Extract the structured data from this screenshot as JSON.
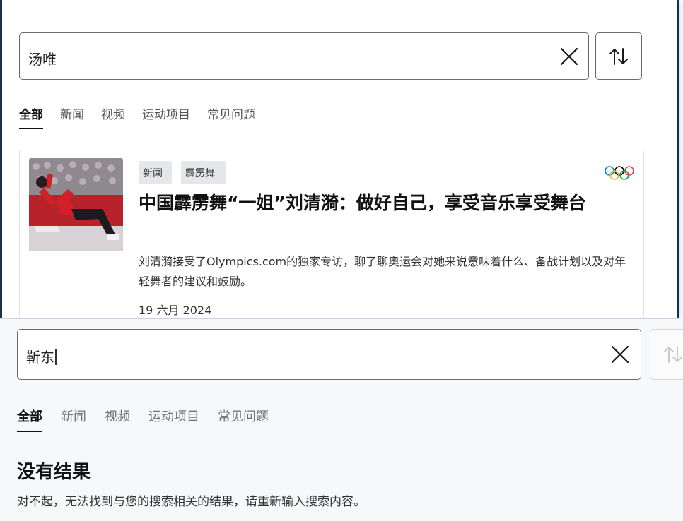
{
  "top_search": {
    "query": "汤唯",
    "tabs": [
      {
        "label": "全部",
        "active": true
      },
      {
        "label": "新闻",
        "active": false
      },
      {
        "label": "视频",
        "active": false
      },
      {
        "label": "运动项目",
        "active": false
      },
      {
        "label": "常见问题",
        "active": false
      }
    ],
    "result": {
      "tags": [
        "新闻",
        "霹雳舞"
      ],
      "headline": "中国霹雳舞“一姐”刘清漪：做好自己，享受音乐享受舞台",
      "description": "刘清漪接受了Olympics.com的独家专访，聊了聊奥运会对她来说意味着什么、备战计划以及对年轻舞者的建议和鼓励。",
      "date": "19 六月 2024"
    }
  },
  "bottom_search": {
    "query": "靳东",
    "tabs": [
      {
        "label": "全部",
        "active": true
      },
      {
        "label": "新闻",
        "active": false
      },
      {
        "label": "视频",
        "active": false
      },
      {
        "label": "运动项目",
        "active": false
      },
      {
        "label": "常见问题",
        "active": false
      }
    ],
    "empty_state": {
      "title": "没有结果",
      "message": "对不起，无法找到与您的搜索相关的结果，请重新输入搜索内容。"
    }
  },
  "icons": {
    "clear": "close-icon",
    "sort": "sort-arrows-icon",
    "brand": "olympic-rings-icon"
  },
  "colors": {
    "panel_frame": "#1b2f4e",
    "tag_bg": "#e6e7ea",
    "rings": [
      "#0081c8",
      "#000000",
      "#ee334e",
      "#fcb131",
      "#00a651"
    ]
  }
}
